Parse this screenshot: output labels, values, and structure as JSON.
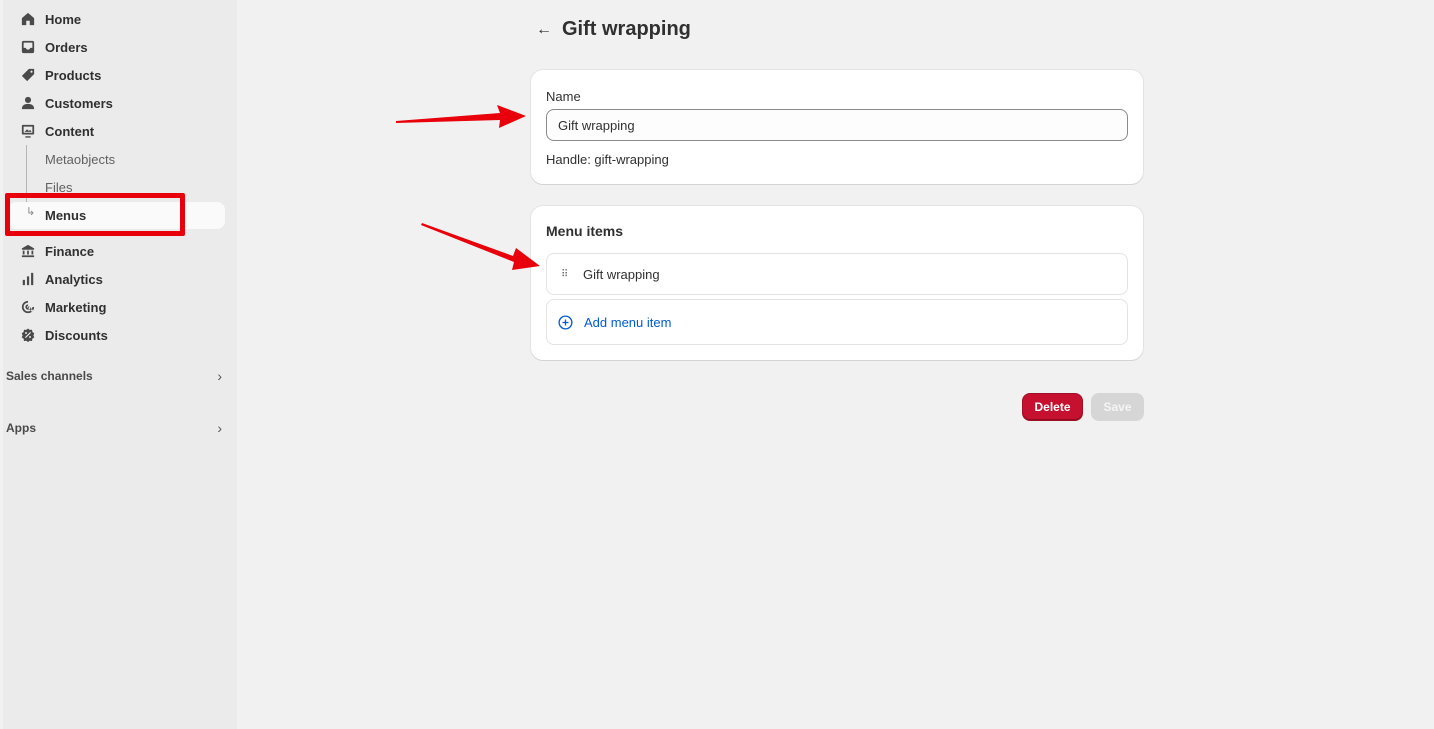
{
  "sidebar": {
    "items": [
      {
        "label": "Home",
        "icon": "home-icon"
      },
      {
        "label": "Orders",
        "icon": "inbox-icon"
      },
      {
        "label": "Products",
        "icon": "tag-icon"
      },
      {
        "label": "Customers",
        "icon": "person-icon"
      },
      {
        "label": "Content",
        "icon": "image-icon"
      }
    ],
    "content_sub": [
      "Metaobjects",
      "Files",
      "Menus"
    ],
    "items2": [
      {
        "label": "Finance",
        "icon": "bank-icon"
      },
      {
        "label": "Analytics",
        "icon": "bar-chart-icon"
      },
      {
        "label": "Marketing",
        "icon": "target-icon"
      },
      {
        "label": "Discounts",
        "icon": "discount-icon"
      }
    ],
    "sales_channels": "Sales channels",
    "apps": "Apps"
  },
  "page": {
    "back": "←",
    "title": "Gift wrapping"
  },
  "name_card": {
    "label": "Name",
    "value": "Gift wrapping",
    "handle": "Handle: gift-wrapping"
  },
  "menu_card": {
    "heading": "Menu items",
    "items": [
      "Gift wrapping"
    ],
    "add_label": "Add menu item"
  },
  "actions": {
    "delete": "Delete",
    "save": "Save"
  },
  "colors": {
    "annotation_red": "#e8000b",
    "delete_bg": "#c5102f",
    "link_blue": "#005bd3"
  }
}
